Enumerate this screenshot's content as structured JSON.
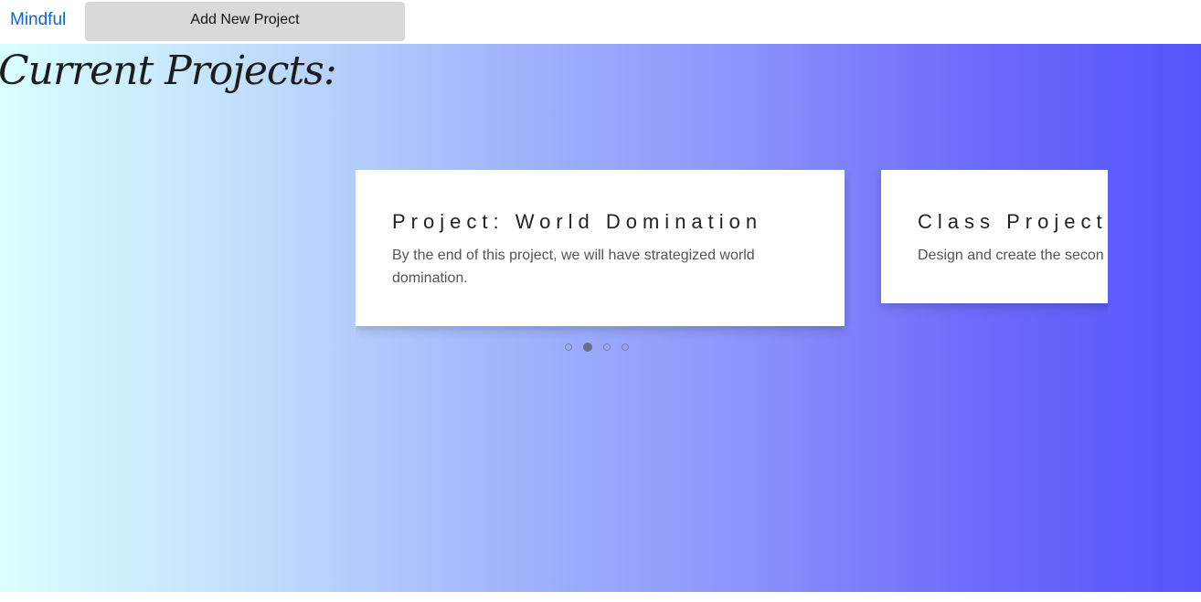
{
  "nav": {
    "brand": "Mindful",
    "add_project_label": "Add New Project"
  },
  "main": {
    "title": "Current Projects:",
    "projects": [
      {
        "title": "Project: World Domination",
        "description": "By the end of this project, we will have strategized world domination."
      },
      {
        "title": "Class Project",
        "description": "Design and create the secon"
      }
    ],
    "carousel": {
      "dot_count": 4,
      "active_index": 1
    }
  },
  "colors": {
    "gradient_start": "#d9ffff",
    "gradient_end": "#5454fa",
    "brand": "#0a66d8",
    "button_bg": "#d9d9d9"
  }
}
